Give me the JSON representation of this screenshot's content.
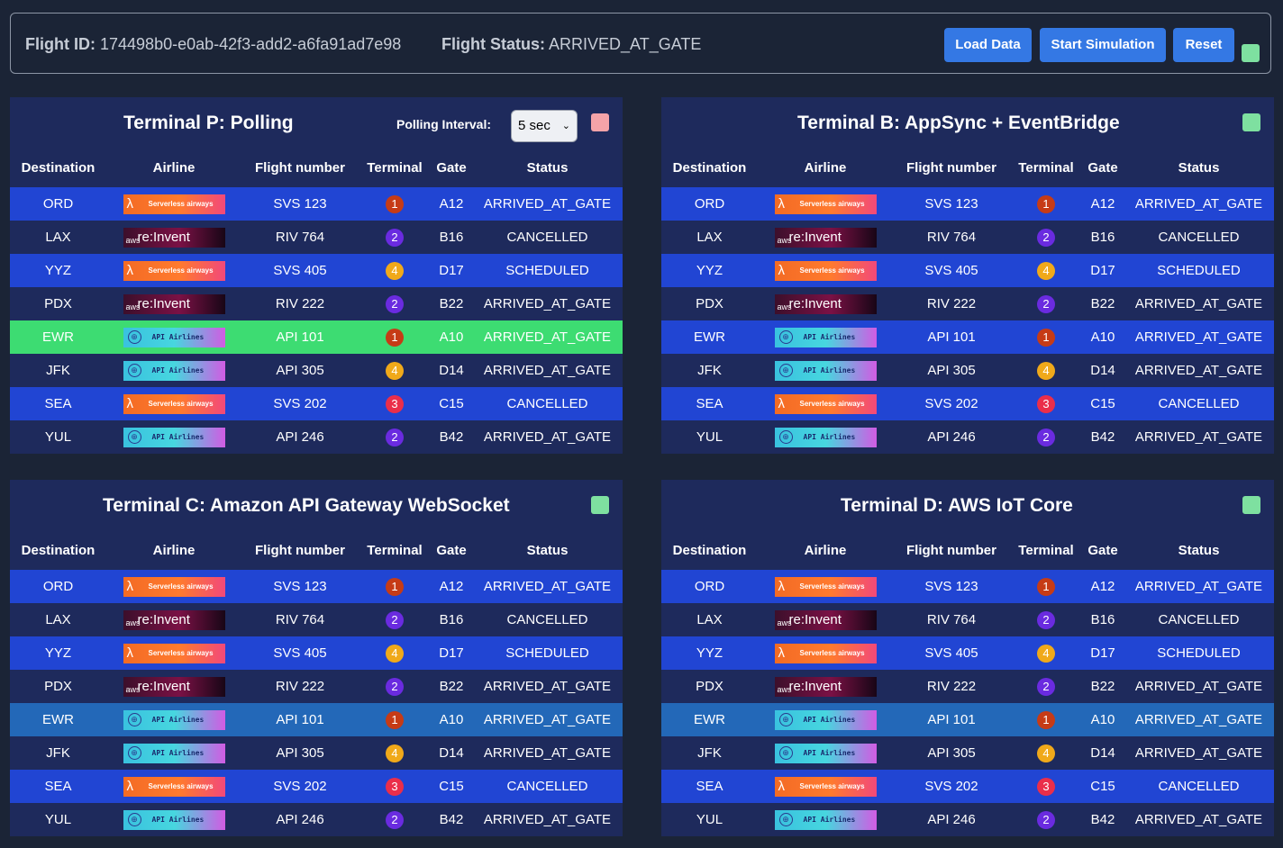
{
  "header": {
    "flight_id_label": "Flight ID:",
    "flight_id": "174498b0-e0ab-42f3-add2-a6fa91ad7e98",
    "flight_status_label": "Flight Status:",
    "flight_status": "ARRIVED_AT_GATE",
    "load_label": "Load Data",
    "start_label": "Start Simulation",
    "reset_label": "Reset",
    "indicator_color": "#7ee0a0"
  },
  "columns": [
    "Destination",
    "Airline",
    "Flight number",
    "Terminal",
    "Gate",
    "Status"
  ],
  "polling": {
    "label": "Polling Interval:",
    "value": "5 sec"
  },
  "panels": [
    {
      "title": "Terminal P: Polling",
      "indicator_color": "#f4a3a8",
      "highlight": "green"
    },
    {
      "title": "Terminal B: AppSync + EventBridge",
      "indicator_color": "#7ee0a0",
      "highlight": "none"
    },
    {
      "title": "Terminal C: Amazon API Gateway WebSocket",
      "indicator_color": "#7ee0a0",
      "highlight": "teal"
    },
    {
      "title": "Terminal D: AWS IoT Core",
      "indicator_color": "#7ee0a0",
      "highlight": "teal"
    }
  ],
  "flights": [
    {
      "destination": "ORD",
      "airline": "serverless",
      "airline_text": "Serverless airways",
      "flight": "SVS 123",
      "terminal": "1",
      "gate": "A12",
      "status": "ARRIVED_AT_GATE"
    },
    {
      "destination": "LAX",
      "airline": "reinvent",
      "airline_text": "re:Invent",
      "flight": "RIV 764",
      "terminal": "2",
      "gate": "B16",
      "status": "CANCELLED"
    },
    {
      "destination": "YYZ",
      "airline": "serverless",
      "airline_text": "Serverless airways",
      "flight": "SVS 405",
      "terminal": "4",
      "gate": "D17",
      "status": "SCHEDULED"
    },
    {
      "destination": "PDX",
      "airline": "reinvent",
      "airline_text": "re:Invent",
      "flight": "RIV 222",
      "terminal": "2",
      "gate": "B22",
      "status": "ARRIVED_AT_GATE"
    },
    {
      "destination": "EWR",
      "airline": "api",
      "airline_text": "API Airlines",
      "flight": "API 101",
      "terminal": "1",
      "gate": "A10",
      "status": "ARRIVED_AT_GATE"
    },
    {
      "destination": "JFK",
      "airline": "api",
      "airline_text": "API Airlines",
      "flight": "API 305",
      "terminal": "4",
      "gate": "D14",
      "status": "ARRIVED_AT_GATE"
    },
    {
      "destination": "SEA",
      "airline": "serverless",
      "airline_text": "Serverless airways",
      "flight": "SVS 202",
      "terminal": "3",
      "gate": "C15",
      "status": "CANCELLED"
    },
    {
      "destination": "YUL",
      "airline": "api",
      "airline_text": "API Airlines",
      "flight": "API 246",
      "terminal": "2",
      "gate": "B42",
      "status": "ARRIVED_AT_GATE"
    }
  ]
}
